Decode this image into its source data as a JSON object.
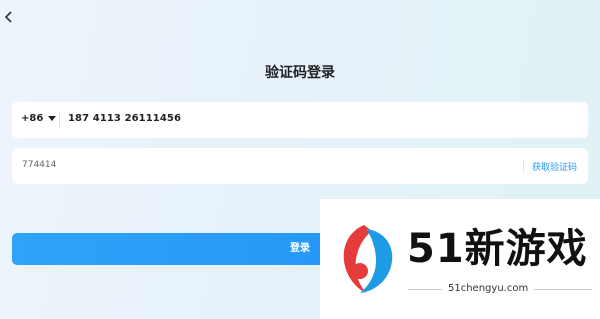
{
  "nav": {
    "back_icon": "chevron-left-icon"
  },
  "page": {
    "title": "验证码登录"
  },
  "phone_field": {
    "country_code": "+86",
    "dropdown_icon": "caret-down-icon",
    "value": "187 4113 26111456"
  },
  "code_field": {
    "value": "774414",
    "get_code_label": "获取验证码"
  },
  "actions": {
    "login_label": "登录"
  },
  "watermark": {
    "name": "51新游戏",
    "url": "51chengyu.com"
  },
  "colors": {
    "accent": "#2a98ee",
    "button": "#1f8ef5",
    "logo_red": "#e63b3b",
    "logo_blue": "#1e9be6"
  }
}
